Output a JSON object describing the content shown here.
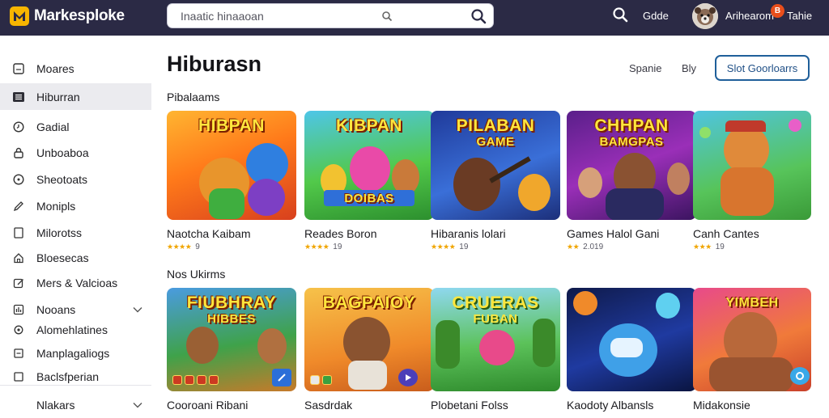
{
  "brand": {
    "name": "Markesploke",
    "accent": "#f7b500"
  },
  "topbar": {
    "bg": "#2b2a45",
    "search_placeholder": "Inaatic hinaaoan",
    "link_label": "Gdde",
    "username": "Arihearom",
    "notif_count": "B",
    "user_extra": "Tahie"
  },
  "sidebar": {
    "items": [
      {
        "label": "Moares",
        "icon": "square-icon"
      },
      {
        "label": "Hiburran",
        "icon": "list-icon",
        "active": true
      },
      {
        "label": "Gadial",
        "icon": "clock-icon"
      },
      {
        "label": "Unboaboa",
        "icon": "lock-icon"
      },
      {
        "label": "Sheotoats",
        "icon": "circle-icon"
      },
      {
        "label": "Monipls",
        "icon": "pencil-icon"
      },
      {
        "label": "Milorotss",
        "icon": "file-icon"
      },
      {
        "label": "Bloesecas",
        "icon": "home-icon"
      },
      {
        "label": "Mers & Valcioas",
        "icon": "edit-icon"
      },
      {
        "label": "Nooans",
        "icon": "bars-icon"
      },
      {
        "label": "Alomehlatines",
        "icon": "gear-icon"
      },
      {
        "label": "Manplagaliogs",
        "icon": "box-icon"
      },
      {
        "label": "Baclsfperian",
        "icon": "box-icon"
      },
      {
        "label": "Nlakars"
      }
    ]
  },
  "main": {
    "title": "Hiburasn",
    "sort_a": "Spanie",
    "sort_b": "Bly",
    "button_label": "Slot Goorloarrs",
    "sections": [
      {
        "title": "Pibalaams",
        "cards": [
          {
            "caption": "HIBPAN",
            "sub": "",
            "title": "Naotcha Kaibam",
            "rating": "9"
          },
          {
            "caption": "KIBPAN",
            "sub": "DOIBAS",
            "title": "Reades Boron",
            "rating": "19"
          },
          {
            "caption": "PILABAN",
            "sub": "GAME",
            "title": "Hibaranis lolari",
            "rating": "19"
          },
          {
            "caption": "CHHPAN",
            "sub": "BAMGPAS",
            "title": "Games Halol Gani",
            "rating": "2.019"
          },
          {
            "caption": "",
            "sub": "",
            "title": "Canh Cantes",
            "rating": "19"
          }
        ]
      },
      {
        "title": "Nos Ukirms",
        "cards": [
          {
            "caption": "FIUBHRAY",
            "sub": "HIBBES",
            "title": "Cooroani Ribani"
          },
          {
            "caption": "BAGPAIOY",
            "sub": "",
            "title": "Sasdrdak"
          },
          {
            "caption": "CRUERAS",
            "sub": "FUBAN",
            "title": "Plobetani Folss"
          },
          {
            "caption": "",
            "sub": "",
            "title": "Kaodoty Albansls"
          },
          {
            "caption": "YIMBEH",
            "sub": "",
            "title": "Midakonsie"
          }
        ]
      }
    ]
  }
}
